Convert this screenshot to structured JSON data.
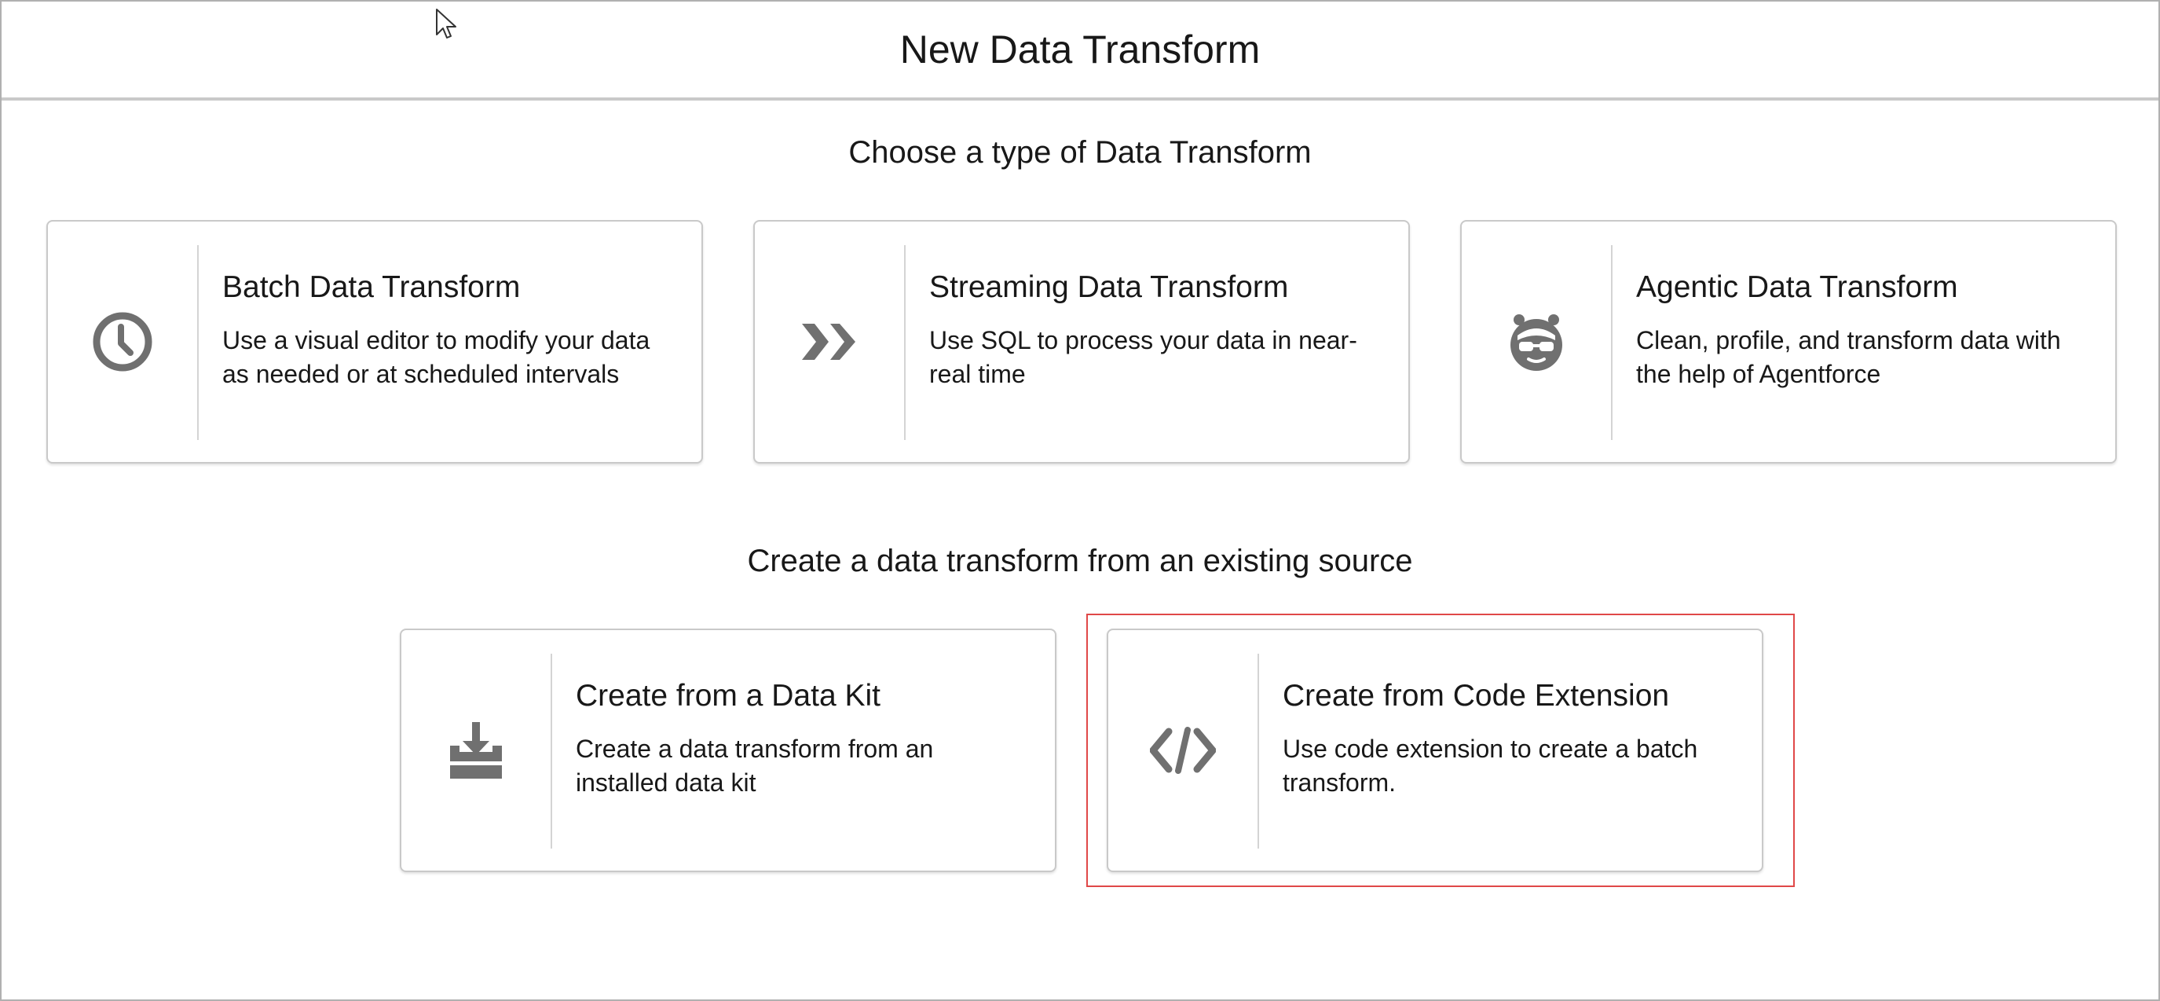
{
  "header": {
    "title": "New Data Transform"
  },
  "sections": {
    "type_title": "Choose a type of Data Transform",
    "source_title": "Create a data transform from an existing source"
  },
  "cards": {
    "batch": {
      "title": "Batch Data Transform",
      "description": "Use a visual editor to modify your data as needed or at scheduled intervals",
      "icon": "clock-icon"
    },
    "streaming": {
      "title": "Streaming Data Transform",
      "description": "Use SQL to process your data in near-real time",
      "icon": "double-chevron-right-icon"
    },
    "agentic": {
      "title": "Agentic Data Transform",
      "description": "Clean, profile, and transform data with the help of Agentforce",
      "icon": "agent-face-icon"
    },
    "data_kit": {
      "title": "Create from a Data Kit",
      "description": "Create a data transform from an installed data kit",
      "icon": "download-tray-icon"
    },
    "code_extension": {
      "title": "Create from Code Extension",
      "description": "Use code extension to create a batch transform.",
      "icon": "code-icon",
      "highlighted": true
    }
  },
  "colors": {
    "icon": "#707070",
    "highlight_border": "#e04848",
    "card_border": "#c9c9c9"
  }
}
